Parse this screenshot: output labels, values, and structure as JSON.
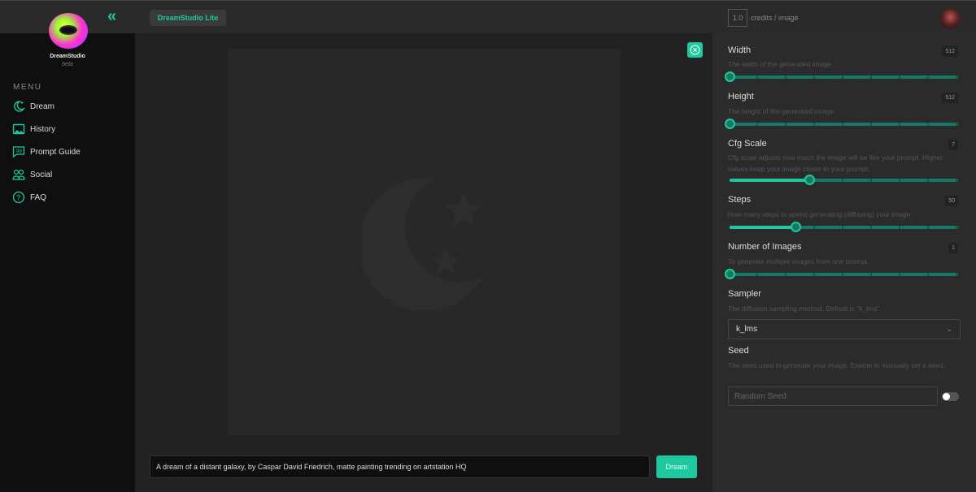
{
  "app": {
    "brand": "DreamStudio",
    "brand_sub": "beta",
    "badge": "DreamStudio Lite"
  },
  "sidebar": {
    "menu_heading": "MENU",
    "items": [
      {
        "label": "Dream",
        "icon": "moon-stars-icon"
      },
      {
        "label": "History",
        "icon": "image-icon"
      },
      {
        "label": "Prompt Guide",
        "icon": "quote-bubble-icon"
      },
      {
        "label": "Social",
        "icon": "users-icon"
      },
      {
        "label": "FAQ",
        "icon": "question-circle-icon"
      }
    ]
  },
  "prompt": {
    "value": "A dream of a distant galaxy, by Caspar David Friedrich, matte painting trending on artstation HQ",
    "button": "Dream"
  },
  "credits": {
    "value": "1.0",
    "label": "credits / image"
  },
  "settings": {
    "width": {
      "label": "Width",
      "value": "512",
      "desc": "The width of the generated image.",
      "fraction": 0
    },
    "height": {
      "label": "Height",
      "value": "512",
      "desc": "The height of the generated image.",
      "fraction": 0
    },
    "cfg": {
      "label": "Cfg Scale",
      "value": "7",
      "desc": "Cfg scale adjusts how much the image will be like your prompt. Higher values keep your image closer to your prompt.",
      "fraction": 0.35
    },
    "steps": {
      "label": "Steps",
      "value": "50",
      "desc": "How many steps to spend generating (diffusing) your image.",
      "fraction": 0.29
    },
    "images": {
      "label": "Number of Images",
      "value": "1",
      "desc": "To generate multiple images from one prompt.",
      "fraction": 0
    },
    "sampler": {
      "label": "Sampler",
      "desc": "The diffusion sampling method. Default is \"k_lms\".",
      "value": "k_lms"
    },
    "seed": {
      "label": "Seed",
      "desc": "The seed used to generate your image. Enable to manually set a seed.",
      "placeholder": "Random Seed",
      "enabled": false
    }
  },
  "colors": {
    "accent": "#1fc9a0",
    "sidebar": "#0f0f0f",
    "panel": "#2b2b2b"
  }
}
